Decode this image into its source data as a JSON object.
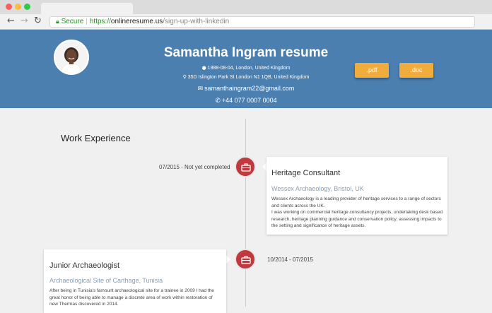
{
  "browser": {
    "url_secure_label": "Secure",
    "url_scheme": "https://",
    "url_host": "onlineresume.us",
    "url_path": "/sign-up-with-linkedin"
  },
  "header": {
    "title": "Samantha Ingram resume",
    "birth": "1988-08-04, London, United Kingdom",
    "address": "35D Islington Park St London N1 1QB, United Kingdom",
    "email": "samanthaingram22@gmail.com",
    "phone": "+44 077 0007 0004",
    "pdf_label": ".pdf",
    "doc_label": ".doc"
  },
  "work": {
    "section_title": "Work Experience",
    "jobs": [
      {
        "date": "07/2015 - Not yet completed",
        "title": "Heritage Consultant",
        "employer": "Wessex Archaeology, Bristol, UK",
        "description": [
          "Wessex Archaeology is a leading provider of heritage services to a range of sectors and clients across the UK.",
          "I was working on commercial heritage consultancy projects, undertaking desk based research, heritage planning guidance and conservation policy; assessing impacts to the setting and significance of heritage assets."
        ]
      },
      {
        "date": "10/2014 - 07/2015",
        "title": "Junior Archaeologist",
        "employer": "Archaeological Site of Carthage, Tunisia",
        "description": [
          "After being in Tunisia's famount archaeological site for a trainee in 2009 I had the great honor of being able to manage a discrete area of work within restoration of new Thermas discovered in 2014."
        ]
      }
    ]
  },
  "colors": {
    "header_bg": "#4a7fb0",
    "accent_button": "#f0ad3e",
    "timeline_bubble": "#c0393f"
  },
  "icons": [
    "back-arrow-icon",
    "forward-arrow-icon",
    "reload-icon",
    "lock-icon",
    "globe-icon",
    "map-marker-icon",
    "envelope-icon",
    "phone-icon",
    "briefcase-icon"
  ]
}
